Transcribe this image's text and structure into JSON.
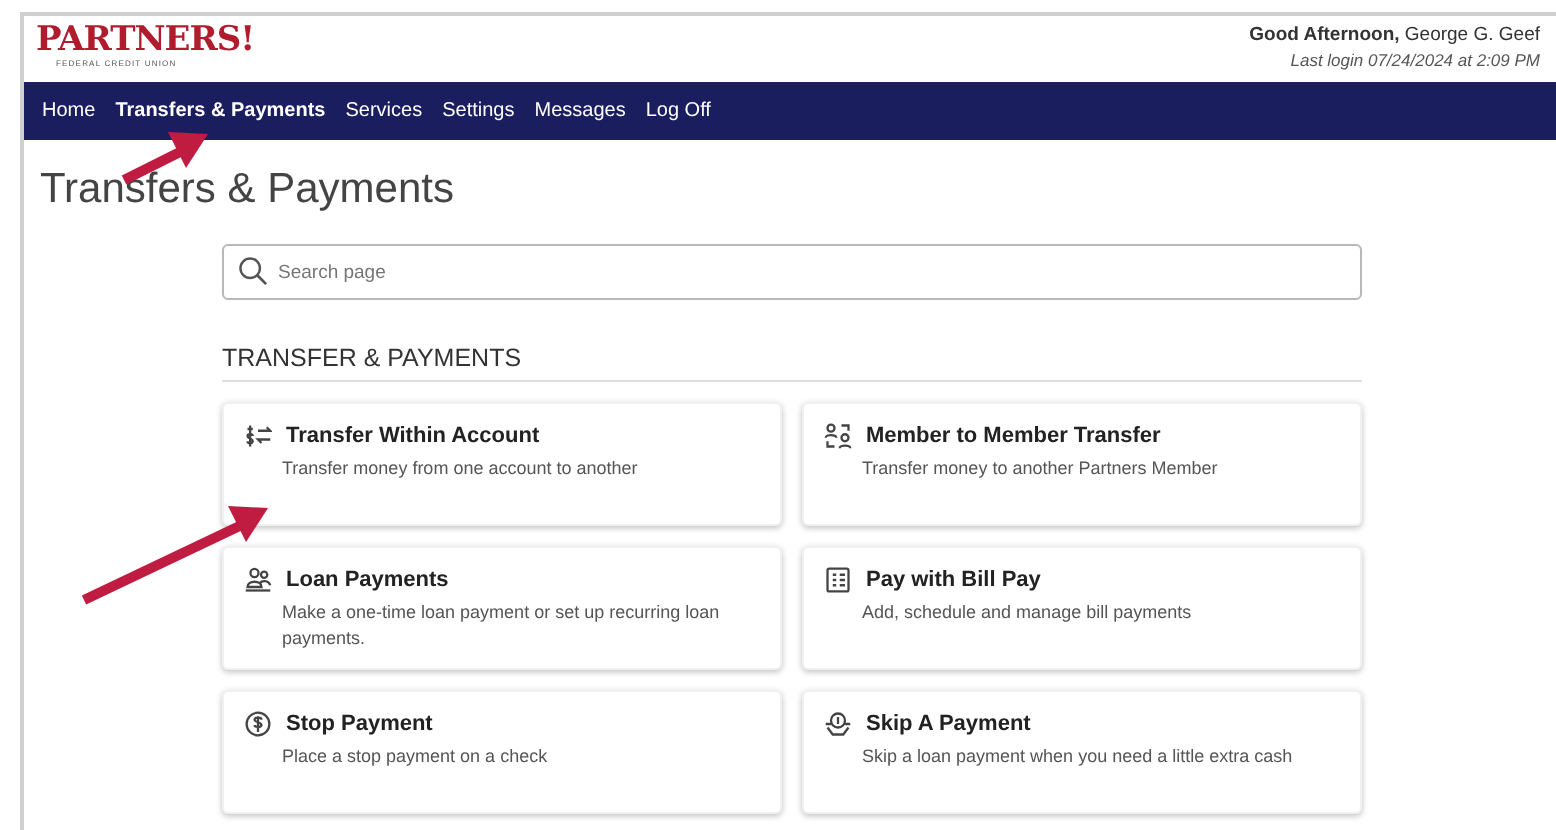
{
  "logo": {
    "name": "PARTNERS!",
    "tagline": "FEDERAL CREDIT UNION"
  },
  "greeting": {
    "text": "**Good Afternoon,** George G. Geef",
    "last_login": "Last login 07/24/2024 at 2:09 PM"
  },
  "nav": [
    {
      "label": "Home",
      "selected": false
    },
    {
      "label": "Transfers & Payments",
      "selected": true
    },
    {
      "label": "Services",
      "selected": false
    },
    {
      "label": "Settings",
      "selected": false
    },
    {
      "label": "Messages",
      "selected": false
    },
    {
      "label": "Log Off",
      "selected": false
    }
  ],
  "page_title": "Transfers & Payments",
  "search": {
    "placeholder": "Search page"
  },
  "section": {
    "heading": "TRANSFER & PAYMENTS",
    "cards": [
      {
        "title": "Transfer Within Account",
        "description": "Transfer money from one account to another"
      },
      {
        "title": "Member to Member Transfer",
        "description": "Transfer money to another Partners Member"
      },
      {
        "title": "Loan Payments",
        "description": "Make a one-time loan payment or set up recurring loan payments."
      },
      {
        "title": "Pay with Bill Pay",
        "description": "Add, schedule and manage bill payments"
      },
      {
        "title": "Stop Payment",
        "description": "Place a stop payment on a check"
      },
      {
        "title": "Skip A Payment",
        "description": "Skip a loan payment when you need a little extra cash"
      }
    ]
  }
}
